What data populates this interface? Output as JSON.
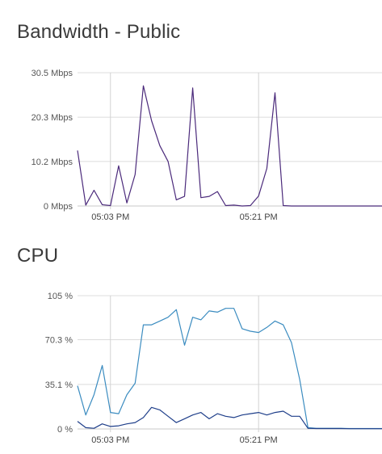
{
  "chart_data": [
    {
      "type": "line",
      "title": "Bandwidth - Public",
      "xlabel": "",
      "ylabel": "",
      "y_ticks": [
        {
          "value": 0,
          "label": "0 Mbps"
        },
        {
          "value": 10.2,
          "label": "10.2 Mbps"
        },
        {
          "value": 20.3,
          "label": "20.3 Mbps"
        },
        {
          "value": 30.5,
          "label": "30.5 Mbps"
        }
      ],
      "ylim": [
        0,
        30.5
      ],
      "x_ticks": [
        {
          "value": 4,
          "label": "05:03 PM"
        },
        {
          "value": 22,
          "label": "05:21 PM"
        }
      ],
      "xlim": [
        0,
        37
      ],
      "grid": true,
      "series": [
        {
          "color": "#4b2a7b",
          "x": [
            0,
            1,
            2,
            3,
            4,
            5,
            6,
            7,
            8,
            9,
            10,
            11,
            12,
            13,
            14,
            15,
            16,
            17,
            18,
            19,
            20,
            21,
            22,
            23,
            24,
            25,
            26,
            27,
            28,
            29,
            30,
            31,
            32,
            33,
            34,
            35,
            36,
            37
          ],
          "values": [
            12.7,
            0.2,
            3.6,
            0.3,
            0.1,
            9.2,
            0.7,
            7.2,
            27.5,
            19.5,
            13.8,
            10.2,
            1.4,
            2.2,
            27.0,
            1.9,
            2.2,
            3.3,
            0.1,
            0.2,
            0,
            0.1,
            2.3,
            8.6,
            25.9,
            0.1,
            0,
            0,
            0,
            0,
            0,
            0,
            0,
            0,
            0,
            0,
            0,
            0
          ]
        }
      ]
    },
    {
      "type": "line",
      "title": "CPU",
      "xlabel": "",
      "ylabel": "",
      "y_ticks": [
        {
          "value": 0,
          "label": "0 %"
        },
        {
          "value": 35.1,
          "label": "35.1 %"
        },
        {
          "value": 70.3,
          "label": "70.3 %"
        },
        {
          "value": 105,
          "label": "105 %"
        }
      ],
      "ylim": [
        0,
        105
      ],
      "x_ticks": [
        {
          "value": 4,
          "label": "05:03 PM"
        },
        {
          "value": 22,
          "label": "05:21 PM"
        }
      ],
      "xlim": [
        0,
        37
      ],
      "grid": true,
      "series": [
        {
          "color": "#3b8cc0",
          "x": [
            0,
            1,
            2,
            3,
            4,
            5,
            6,
            7,
            8,
            9,
            10,
            11,
            12,
            13,
            14,
            15,
            16,
            17,
            18,
            19,
            20,
            21,
            22,
            23,
            24,
            25,
            26,
            27,
            28,
            29,
            30,
            31,
            32,
            33,
            34,
            35,
            36,
            37
          ],
          "values": [
            34,
            11,
            27,
            50,
            13,
            12,
            27,
            36,
            82,
            82,
            85,
            88,
            94,
            66,
            88,
            86,
            93,
            92,
            95,
            95,
            79,
            77,
            76,
            80,
            85,
            82,
            68,
            39,
            1,
            0.5,
            0.5,
            0.5,
            0.5,
            0.3,
            0.3,
            0.3,
            0.3,
            0.3
          ]
        },
        {
          "color": "#1f3f8a",
          "x": [
            0,
            1,
            2,
            3,
            4,
            5,
            6,
            7,
            8,
            9,
            10,
            11,
            12,
            13,
            14,
            15,
            16,
            17,
            18,
            19,
            20,
            21,
            22,
            23,
            24,
            25,
            26,
            27,
            28,
            29,
            30,
            31,
            32,
            33,
            34,
            35,
            36,
            37
          ],
          "values": [
            6,
            1,
            0.5,
            4,
            2,
            2.5,
            4,
            5,
            9,
            17,
            15,
            10,
            5,
            8,
            11,
            13,
            8,
            12,
            10,
            9,
            11,
            12,
            13,
            11,
            13,
            14,
            10,
            10,
            0.5,
            0.3,
            0.3,
            0.3,
            0.3,
            0.2,
            0.2,
            0.2,
            0.2,
            0.2
          ]
        }
      ]
    }
  ]
}
